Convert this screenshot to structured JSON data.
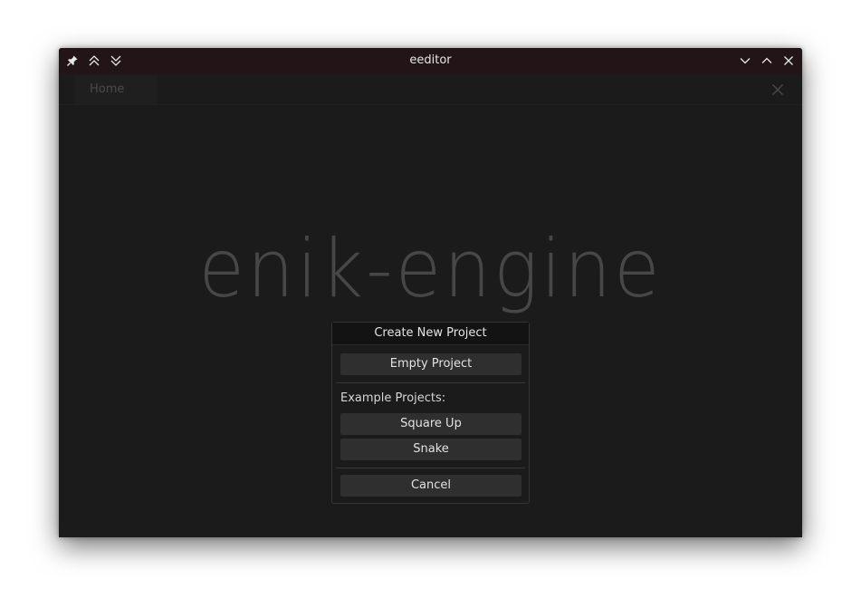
{
  "window": {
    "title": "eeditor",
    "titlebar_color": "#231418",
    "left_icons": [
      "pin-icon",
      "keep-above-icon",
      "keep-below-icon"
    ],
    "right_icons": [
      "minimize-icon",
      "maximize-icon",
      "close-icon"
    ]
  },
  "tabs": [
    {
      "label": "Home"
    }
  ],
  "home": {
    "logo_text": "enik-engine"
  },
  "dialog": {
    "title": "Create New Project",
    "empty_project_label": "Empty Project",
    "examples_label": "Example Projects:",
    "examples": [
      {
        "label": "Square Up"
      },
      {
        "label": "Snake"
      }
    ],
    "cancel_label": "Cancel"
  }
}
